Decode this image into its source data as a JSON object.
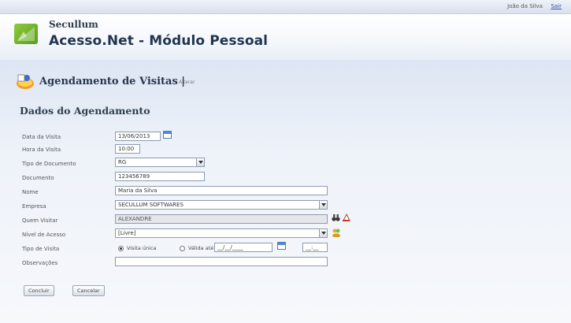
{
  "topbar": {
    "user": "João da Silva",
    "logout": "Sair"
  },
  "header": {
    "brand": "Secullum",
    "title": "Acesso.Net - Módulo Pessoal"
  },
  "page": {
    "title": "Agendamento de Visitas |",
    "subtitle": "Alterar"
  },
  "section": {
    "title": "Dados do Agendamento"
  },
  "form": {
    "data_visita": {
      "label": "Data da Visita",
      "value": "13/06/2013"
    },
    "hora_visita": {
      "label": "Hora da Visita",
      "value": "10:00"
    },
    "tipo_documento": {
      "label": "Tipo de Documento",
      "value": "RG"
    },
    "documento": {
      "label": "Documento",
      "value": "123456789"
    },
    "nome": {
      "label": "Nome",
      "value": "Maria da Silva"
    },
    "empresa": {
      "label": "Empresa",
      "value": "SECULLUM SOFTWARES"
    },
    "quem_visitar": {
      "label": "Quem Visitar",
      "value": "ALEXANDRE"
    },
    "nivel_acesso": {
      "label": "Nível de Acesso",
      "value": "[Livre]"
    },
    "tipo_visita": {
      "label": "Tipo de Visita",
      "option_unica": "Visita única",
      "option_valida": "Válida até",
      "date_value": "__/__/____",
      "time_value": "__:__",
      "selected": "Visita única"
    },
    "observacoes": {
      "label": "Observações",
      "value": ""
    }
  },
  "buttons": {
    "concluir": "Concluir",
    "cancelar": "Cancelar"
  },
  "colors": {
    "accent": "#2b55a8",
    "logo_green": "#7cbf33",
    "title": "#1f3550"
  },
  "icons": {
    "logo": "secullum-logo-icon",
    "page": "calendar-person-icon",
    "calendar": "calendar-icon",
    "search": "binoculars-icon",
    "clear": "eraser-icon",
    "levels": "people-icon"
  }
}
